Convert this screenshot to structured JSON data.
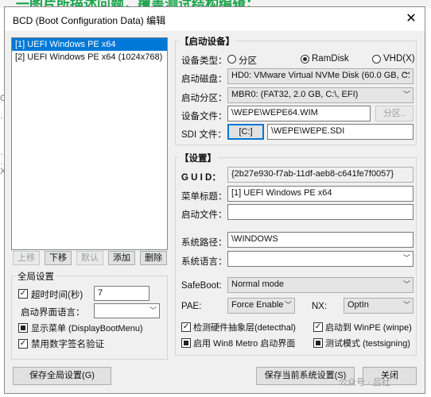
{
  "background": {
    "top_text": "⼀图⽚所描述问题，覆盖测试结构编辑；",
    "left_chars": [
      "C",
      "…",
      "…",
      "…",
      "X"
    ]
  },
  "window": {
    "title": "BCD (Boot Configuration Data) 编辑",
    "close_symbol": "✕"
  },
  "entries": {
    "items": [
      {
        "label": "[1] UEFI Windows PE x64",
        "selected": true
      },
      {
        "label": "[2] UEFI Windows PE x64 (1024x768)",
        "selected": false
      }
    ],
    "buttons": {
      "up": "上移",
      "down": "下移",
      "default": "默认",
      "add": "添加",
      "delete": "删除"
    }
  },
  "global": {
    "title": "全局设置",
    "timeout_label": "超时时间(秒)",
    "timeout_value": "7",
    "lang_label": "启动界面语言：",
    "lang_value": "",
    "show_menu_label": "显示菜单 (DisplayBootMenu)",
    "disable_sig_label": "禁用数字签名验证"
  },
  "boot_device": {
    "title": "【启动设备】",
    "type_label": "设备类型：",
    "type_options": {
      "partition": "分区",
      "ramdisk": "RamDisk",
      "vhd": "VHD(X)"
    },
    "type_selected": "ramdisk",
    "disk_label": "启动磁盘：",
    "disk_value": "HD0: VMware Virtual NVMe Disk (60.0 GB, C: E",
    "partition_label": "启动分区：",
    "partition_value": "MBR0: (FAT32,   2.0 GB, C:\\, EFI)",
    "file_label": "设备文件：",
    "file_value": "\\WEPE\\WEPE64.WIM",
    "partition_btn": "分区..",
    "sdi_label": "SDI 文件：",
    "sdi_btn": "[C:]",
    "sdi_value": "\\WEPE\\WEPE.SDI"
  },
  "settings": {
    "title": "【设置】",
    "guid_label": "G U I D：",
    "guid_value": "{2b27e930-f7ab-11df-aeb8-c641fe7f0057}",
    "menu_title_label": "菜单标题：",
    "menu_title_value": "[1] UEFI Windows PE x64",
    "boot_file_label": "启动文件：",
    "boot_file_value": "",
    "sys_path_label": "系统路径：",
    "sys_path_value": "\\WINDOWS",
    "sys_lang_label": "系统语言：",
    "sys_lang_value": "",
    "safeboot_label": "SafeBoot:",
    "safeboot_value": "Normal mode",
    "pae_label": "PAE:",
    "pae_value": "Force Enable",
    "nx_label": "NX:",
    "nx_value": "OptIn",
    "detect_hal_label": "检测硬件抽象层(detecthal)",
    "winpe_label": "启动到 WinPE (winpe)",
    "metro_label": "启用 Win8 Metro 启动界面",
    "testsign_label": "测试模式 (testsigning)"
  },
  "footer": {
    "save_global": "保存全局设置(G)",
    "save_current": "保存当前系统设置(S)",
    "close": "关闭",
    "watermark": "公众号 · 吕社"
  }
}
